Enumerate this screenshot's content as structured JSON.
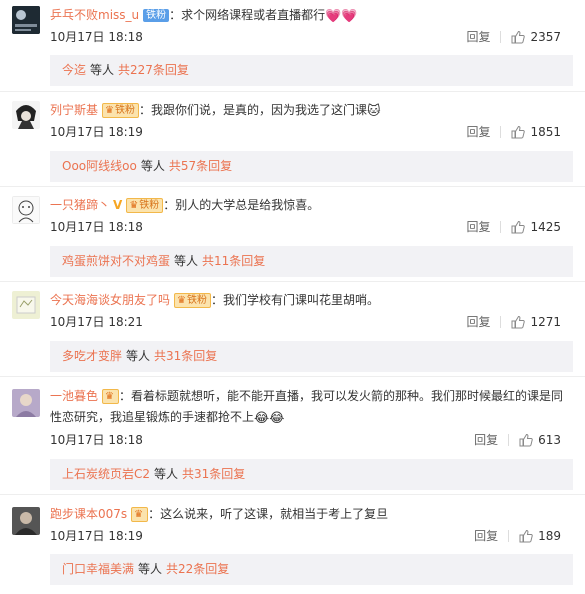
{
  "comments": [
    {
      "username": "乒乓不败miss_u",
      "badge": "铁粉",
      "vip": false,
      "text": "求个网络课程或者直播都行",
      "emoji": "💗💗",
      "time": "10月17日 18:18",
      "reply_label": "回复",
      "likes": "2357",
      "replies": {
        "user": "今迄",
        "mid": "等人",
        "total": "共227条回复"
      }
    },
    {
      "username": "列宁斯基",
      "badge": "铁粉",
      "vip": false,
      "text": "我跟你们说，是真的，因为我选了这门课",
      "emoji": "🐱",
      "time": "10月17日 18:19",
      "reply_label": "回复",
      "likes": "1851",
      "replies": {
        "user": "Ooo阿线线oo",
        "mid": "等人",
        "total": "共57条回复"
      }
    },
    {
      "username": "一只猪蹄丶",
      "badge": "铁粉",
      "vip": true,
      "text": "别人的大学总是给我惊喜。",
      "emoji": "",
      "time": "10月17日 18:18",
      "reply_label": "回复",
      "likes": "1425",
      "replies": {
        "user": "鸡蛋煎饼对不对鸡蛋",
        "mid": "等人",
        "total": "共11条回复"
      }
    },
    {
      "username": "今天海海谈女朋友了吗",
      "badge": "铁粉",
      "vip": false,
      "text": "我们学校有门课叫花里胡哨。",
      "emoji": "",
      "time": "10月17日 18:21",
      "reply_label": "回复",
      "likes": "1271",
      "replies": {
        "user": "多吃才变胖",
        "mid": "等人",
        "total": "共31条回复"
      }
    },
    {
      "username": "一池暮色",
      "badge": "",
      "vip": false,
      "text": "看着标题就想听，能不能开直播，我可以发火箭的那种。我们那时候最红的课是同性恋研究，我追星锻炼的手速都抢不上",
      "emoji": "😂😂",
      "time": "10月17日 18:18",
      "reply_label": "回复",
      "likes": "613",
      "replies": {
        "user": "上石炭统页岩C2",
        "mid": "等人",
        "total": "共31条回复"
      }
    },
    {
      "username": "跑步课本007s",
      "badge": "",
      "vip": false,
      "text": "这么说来，听了这课，就相当于考上了复旦",
      "emoji": "",
      "time": "10月17日 18:19",
      "reply_label": "回复",
      "likes": "189",
      "replies": {
        "user": "门口幸福美满",
        "mid": "等人",
        "total": "共22条回复"
      }
    }
  ]
}
